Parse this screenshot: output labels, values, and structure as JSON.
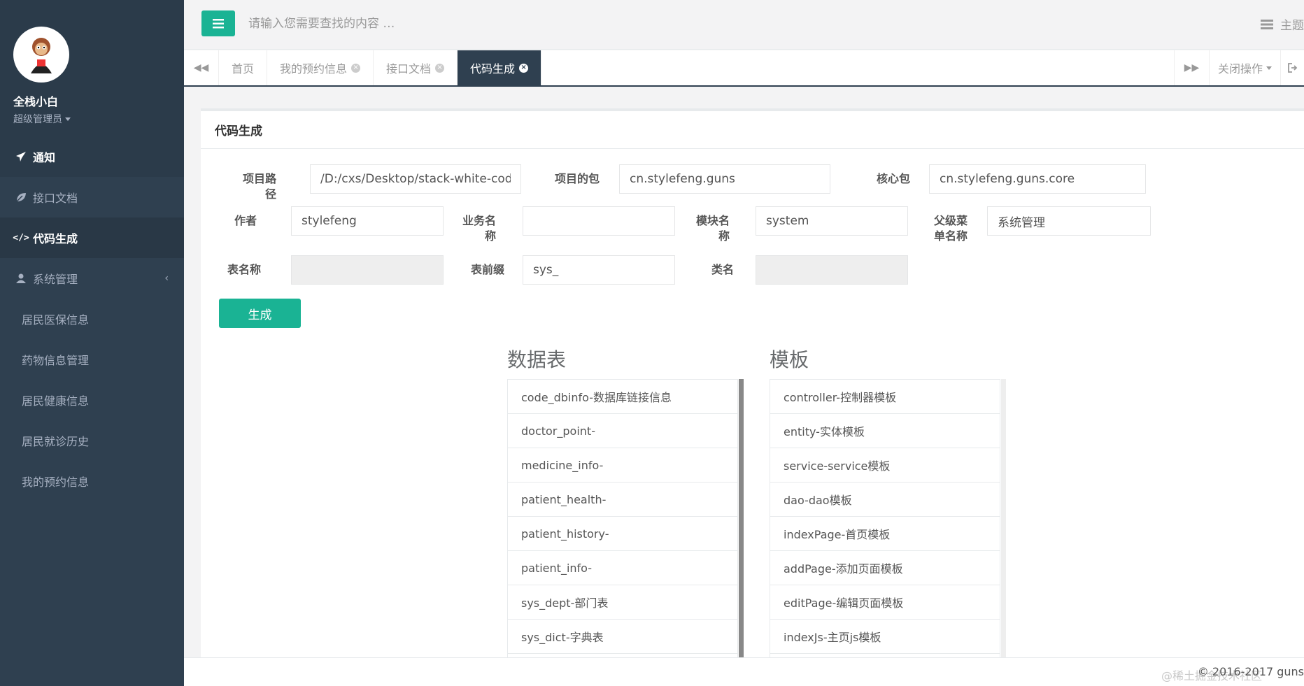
{
  "sidebar": {
    "user_name": "全栈小白",
    "user_role": "超级管理员",
    "items": [
      {
        "label": "通知"
      },
      {
        "label": "接口文档"
      },
      {
        "label": "代码生成"
      },
      {
        "label": "系统管理"
      }
    ],
    "sub_items": [
      {
        "label": "居民医保信息"
      },
      {
        "label": "药物信息管理"
      },
      {
        "label": "居民健康信息"
      },
      {
        "label": "居民就诊历史"
      },
      {
        "label": "我的预约信息"
      }
    ]
  },
  "topbar": {
    "search_placeholder": "请输入您需要查找的内容 …",
    "theme_label": "主题"
  },
  "tabs": {
    "items": [
      {
        "label": "首页"
      },
      {
        "label": "我的预约信息"
      },
      {
        "label": "接口文档"
      },
      {
        "label": "代码生成"
      }
    ],
    "close_ops": "关闭操作"
  },
  "panel": {
    "title": "代码生成",
    "fields": {
      "project_path": {
        "label": "项目路径",
        "value": "/D:/cxs/Desktop/stack-white-code/code/"
      },
      "project_package": {
        "label": "项目的包",
        "value": "cn.stylefeng.guns"
      },
      "core_package": {
        "label": "核心包",
        "value": "cn.stylefeng.guns.core"
      },
      "author": {
        "label": "作者",
        "value": "stylefeng"
      },
      "biz_name": {
        "label": "业务名称",
        "value": ""
      },
      "module_name": {
        "label": "模块名称",
        "value": "system"
      },
      "parent_menu": {
        "label": "父级菜单名称",
        "value": "系统管理"
      },
      "table_name": {
        "label": "表名称",
        "value": ""
      },
      "table_prefix": {
        "label": "表前缀",
        "value": "sys_"
      },
      "class_name": {
        "label": "类名",
        "value": ""
      }
    },
    "generate_label": "生成",
    "tables_title": "数据表",
    "templates_title": "模板",
    "tables": [
      "code_dbinfo-数据库链接信息",
      "doctor_point-",
      "medicine_info-",
      "patient_health-",
      "patient_history-",
      "patient_info-",
      "sys_dept-部门表",
      "sys_dict-字典表",
      ""
    ],
    "templates": [
      "controller-控制器模板",
      "entity-实体模板",
      "service-service模板",
      "dao-dao模板",
      "indexPage-首页模板",
      "addPage-添加页面模板",
      "editPage-编辑页面模板",
      "indexJs-主页js模板",
      ""
    ]
  },
  "footer": {
    "copyright": "© 2016-2017 guns",
    "watermark": "@稀土掘金技术社区"
  },
  "colors": {
    "sidebar_bg": "#2f4050",
    "accent": "#1ab394"
  }
}
